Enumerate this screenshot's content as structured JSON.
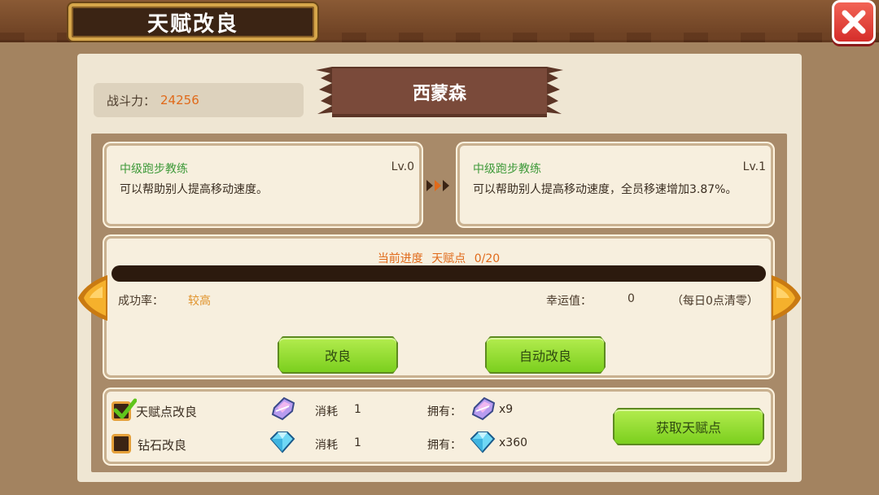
{
  "window": {
    "title": "天赋改良"
  },
  "header": {
    "power_label": "战斗力：",
    "power_value": "24256",
    "character_name": "西蒙森"
  },
  "talent_current": {
    "name": "中级跑步教练",
    "level": "Lv.0",
    "description": "可以帮助别人提高移动速度。"
  },
  "talent_next": {
    "name": "中级跑步教练",
    "level": "Lv.1",
    "description": "可以帮助别人提高移动速度，全员移速增加3.87%。"
  },
  "progress": {
    "label": "当前进度",
    "resource": "天赋点",
    "text": "0/20",
    "current": 0,
    "max": 20
  },
  "stats": {
    "success_label": "成功率：",
    "success_value": "较高",
    "luck_label": "幸运值：",
    "luck_value": "0",
    "luck_note": "（每日0点清零）"
  },
  "buttons": {
    "improve": "改良",
    "auto_improve": "自动改良",
    "get_points": "获取天赋点"
  },
  "options": [
    {
      "label": "天赋点改良",
      "checked": true,
      "icon": "talent-crystal-icon",
      "cost_label": "消耗",
      "cost_value": "1",
      "own_label": "拥有：",
      "own_value": "x9"
    },
    {
      "label": "钻石改良",
      "checked": false,
      "icon": "diamond-icon",
      "cost_label": "消耗",
      "cost_value": "1",
      "own_label": "拥有：",
      "own_value": "x360"
    }
  ],
  "colors": {
    "accent_orange": "#e06a1a",
    "talent_green": "#3f9a3a",
    "button_green": "#7bcf1e",
    "close_red": "#d52d2a",
    "banner_brown": "#7a4a3a"
  }
}
